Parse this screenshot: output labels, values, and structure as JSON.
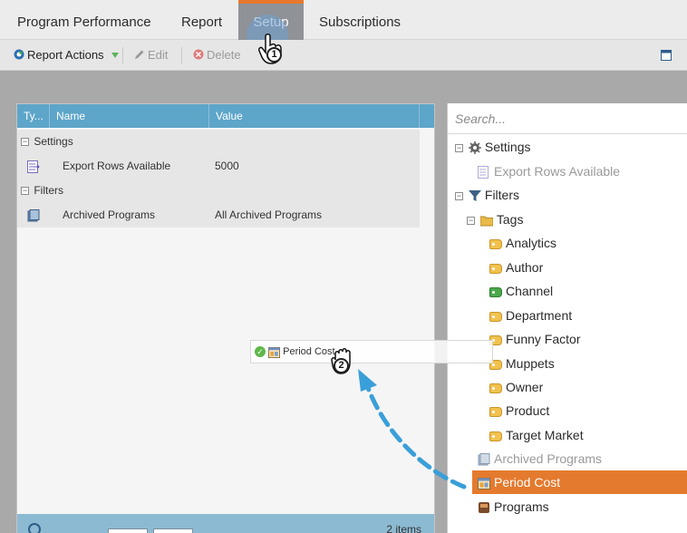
{
  "tabs": [
    {
      "label": "Program Performance",
      "active": false
    },
    {
      "label": "Report",
      "active": false
    },
    {
      "label": "Setup",
      "active": true
    },
    {
      "label": "Subscriptions",
      "active": false
    }
  ],
  "toolbar": {
    "report_actions": "Report Actions",
    "edit": "Edit",
    "delete": "Delete"
  },
  "grid": {
    "columns": [
      "Ty...",
      "Name",
      "Value"
    ],
    "groups": [
      {
        "label": "Settings",
        "rows": [
          {
            "name": "Export Rows Available",
            "value": "5000"
          }
        ]
      },
      {
        "label": "Filters",
        "rows": [
          {
            "name": "Archived Programs",
            "value": "All Archived Programs"
          }
        ]
      }
    ],
    "footer_count": "2 items"
  },
  "tree": {
    "search_placeholder": "Search...",
    "settings": "Settings",
    "export_rows": "Export Rows Available",
    "filters": "Filters",
    "tags": "Tags",
    "tag_items": [
      "Analytics",
      "Author",
      "Channel",
      "Department",
      "Funny Factor",
      "Muppets",
      "Owner",
      "Product",
      "Target Market"
    ],
    "archived_programs": "Archived Programs",
    "period_cost": "Period Cost",
    "programs": "Programs"
  },
  "drag_ghost": {
    "label": "Period Cost"
  },
  "callouts": {
    "one": "1",
    "two": "2"
  },
  "colors": {
    "accent": "#e47a2e",
    "header": "#5da5c9",
    "selected": "#e47a2e",
    "arrow": "#3a9fd8"
  }
}
